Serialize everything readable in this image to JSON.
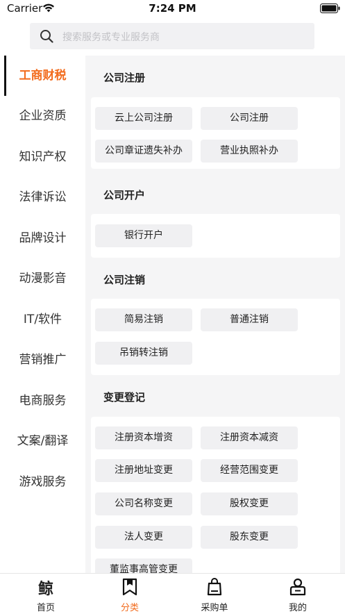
{
  "status_bar": {
    "carrier": "Carrier",
    "time": "7:24 PM"
  },
  "search": {
    "placeholder": "搜索服务或专业服务商"
  },
  "sidebar": {
    "items": [
      {
        "label": "工商财税",
        "active": true
      },
      {
        "label": "企业资质"
      },
      {
        "label": "知识产权"
      },
      {
        "label": "法律诉讼"
      },
      {
        "label": "品牌设计"
      },
      {
        "label": "动漫影音"
      },
      {
        "label": "IT/软件"
      },
      {
        "label": "营销推广"
      },
      {
        "label": "电商服务"
      },
      {
        "label": "文案/翻译"
      },
      {
        "label": "游戏服务"
      }
    ]
  },
  "sections": [
    {
      "title": "公司注册",
      "items": [
        "云上公司注册",
        "公司注册",
        "公司章证遗失补办",
        "营业执照补办"
      ]
    },
    {
      "title": "公司开户",
      "items": [
        "银行开户"
      ]
    },
    {
      "title": "公司注销",
      "items": [
        "简易注销",
        "普通注销",
        "吊销转注销"
      ]
    },
    {
      "title": "变更登记",
      "items": [
        "注册资本增资",
        "注册资本减资",
        "注册地址变更",
        "经营范围变更",
        "公司名称变更",
        "股权变更",
        "法人变更",
        "股东变更",
        "董监事高管变更"
      ]
    }
  ],
  "tabbar": {
    "logo_glyph": "鲸",
    "tabs": [
      {
        "label": "首页"
      },
      {
        "label": "分类",
        "active": true
      },
      {
        "label": "采购单"
      },
      {
        "label": "我的"
      }
    ]
  },
  "colors": {
    "accent": "#f26b1d",
    "content_bg": "#f5f5f6",
    "chip_bg": "#f0f0f2"
  }
}
